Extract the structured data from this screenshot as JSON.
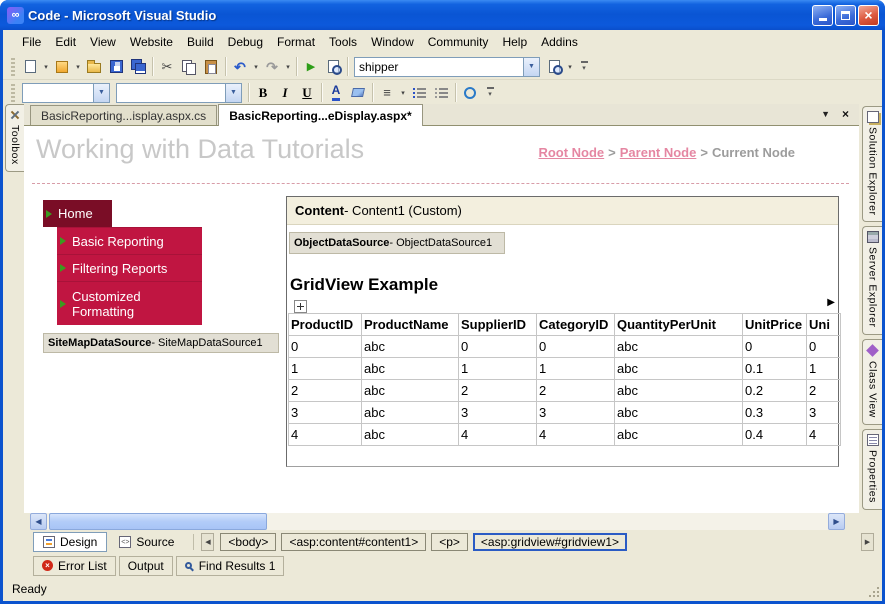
{
  "colors": {
    "titlebar_blue": "#0B53CE",
    "close_red": "#D9422A",
    "toolbar_bg": "#ECE9D8",
    "nav_home_bg": "#7A0D26",
    "nav_item_bg": "#C01541",
    "breadcrumb_link_pink": "#E586A2",
    "heading_gray": "#C8C8C8",
    "selection_blue": "#2A5BC4"
  },
  "icons": {
    "app_logo": "∞",
    "window_close": "×",
    "dropdown": "▾",
    "combo_arrow": "▼",
    "scissors": "✂",
    "undo": "↶",
    "redo": "↷",
    "play": "▶",
    "align_lines": "≡",
    "tab_list_arrow": "▼",
    "tab_close": "×",
    "smart_tag": "▶",
    "scroll_left": "◀",
    "scroll_right": "▶"
  },
  "window": {
    "title": "Code - Microsoft Visual Studio"
  },
  "menubar": {
    "items": [
      "File",
      "Edit",
      "View",
      "Website",
      "Build",
      "Debug",
      "Format",
      "Tools",
      "Window",
      "Community",
      "Help",
      "Addins"
    ]
  },
  "standard_toolbar": {
    "combo_value": "shipper"
  },
  "formatting_toolbar": {
    "block_format_value": "",
    "font_name_value": "",
    "bold": "B",
    "italic": "I",
    "underline": "U",
    "font_color": "A"
  },
  "document_tabs": [
    {
      "label": "BasicReporting...isplay.aspx.cs"
    },
    {
      "label": "BasicReporting...eDisplay.aspx*"
    }
  ],
  "left_panel": {
    "toolbox": "Toolbox"
  },
  "right_panel": {
    "tabs": [
      "Solution Explorer",
      "Server Explorer",
      "Class View",
      "Properties"
    ]
  },
  "designer": {
    "page_heading": "Working with Data Tutorials",
    "breadcrumb": {
      "root": "Root Node",
      "separator": ">",
      "parent": "Parent Node",
      "current": "Current Node"
    },
    "nav_menu": {
      "home": "Home",
      "items": [
        "Basic Reporting",
        "Filtering Reports",
        "Customized Formatting"
      ]
    },
    "sitemap_datasource": {
      "name": "SiteMapDataSource",
      "suffix": " - SiteMapDataSource1"
    },
    "content_control": {
      "name": "Content",
      "suffix": " - Content1 (Custom)"
    },
    "object_datasource": {
      "name": "ObjectDataSource",
      "suffix": " - ObjectDataSource1"
    },
    "gridview": {
      "heading": "GridView Example",
      "columns": [
        "ProductID",
        "ProductName",
        "SupplierID",
        "CategoryID",
        "QuantityPerUnit",
        "UnitPrice",
        "Uni"
      ],
      "rows": [
        [
          "0",
          "abc",
          "0",
          "0",
          "abc",
          "0",
          "0"
        ],
        [
          "1",
          "abc",
          "1",
          "1",
          "abc",
          "0.1",
          "1"
        ],
        [
          "2",
          "abc",
          "2",
          "2",
          "abc",
          "0.2",
          "2"
        ],
        [
          "3",
          "abc",
          "3",
          "3",
          "abc",
          "0.3",
          "3"
        ],
        [
          "4",
          "abc",
          "4",
          "4",
          "abc",
          "0.4",
          "4"
        ]
      ]
    }
  },
  "view_bar": {
    "design": "Design",
    "source": "Source",
    "tag_path": [
      "<body>",
      "<asp:content#content1>",
      "<p>",
      "<asp:gridview#gridview1>"
    ]
  },
  "panel_tabs": [
    "Error List",
    "Output",
    "Find Results 1"
  ],
  "status_bar": {
    "text": "Ready"
  }
}
